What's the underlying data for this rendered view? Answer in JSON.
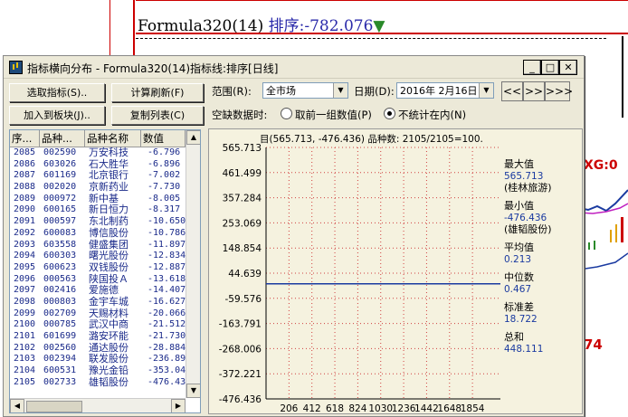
{
  "background": {
    "formula_label": "Formula320(14)",
    "sort_label": "排序:",
    "sort_value": "-782.076",
    "indicator_xg": "XG:0",
    "indicator_74": "74"
  },
  "dialog": {
    "title": "指标横向分布 - Formula320(14)指标线:排序[日线]",
    "buttons": {
      "select_indicator": "选取指标(S)..",
      "calc_refresh": "计算刷新(F)",
      "add_to_block": "加入到板块(J)..",
      "copy_list": "复制列表(C)"
    },
    "range_label": "范围(R):",
    "range_value": "全市场",
    "date_label": "日期(D):",
    "date_value": "2016年 2月16日",
    "nav": [
      "<<",
      ">>",
      ">>>"
    ],
    "empty_data_label": "空缺数据时:",
    "radio_prev": "取前一组数值(P)",
    "radio_skip": "不统计在内(N)",
    "radio_selected": "radio_skip"
  },
  "list": {
    "headers": [
      "序...",
      "品种...",
      "品种名称",
      "数值"
    ],
    "rows": [
      [
        "2085",
        "002590",
        "万安科技",
        "-6.796"
      ],
      [
        "2086",
        "603026",
        "石大胜华",
        "-6.896"
      ],
      [
        "2087",
        "601169",
        "北京银行",
        "-7.002"
      ],
      [
        "2088",
        "002020",
        "京新药业",
        "-7.730"
      ],
      [
        "2089",
        "000972",
        "新中基",
        "-8.005"
      ],
      [
        "2090",
        "600165",
        "新日恒力",
        "-8.317"
      ],
      [
        "2091",
        "000597",
        "东北制药",
        "-10.650"
      ],
      [
        "2092",
        "600083",
        "博信股份",
        "-10.786"
      ],
      [
        "2093",
        "603558",
        "健盛集团",
        "-11.897"
      ],
      [
        "2094",
        "600303",
        "曙光股份",
        "-12.834"
      ],
      [
        "2095",
        "600623",
        "双钱股份",
        "-12.887"
      ],
      [
        "2096",
        "000563",
        "陕国投Ａ",
        "-13.618"
      ],
      [
        "2097",
        "002416",
        "爱施德",
        "-14.407"
      ],
      [
        "2098",
        "000803",
        "金宇车城",
        "-16.627"
      ],
      [
        "2099",
        "002709",
        "天赐材料",
        "-20.066"
      ],
      [
        "2100",
        "000785",
        "武汉中商",
        "-21.512"
      ],
      [
        "2101",
        "601699",
        "潞安环能",
        "-21.730"
      ],
      [
        "2102",
        "002560",
        "通达股份",
        "-28.884"
      ],
      [
        "2103",
        "002394",
        "联发股份",
        "-236.898"
      ],
      [
        "2104",
        "600531",
        "豫光金铅",
        "-353.043"
      ],
      [
        "2105",
        "002733",
        "雄韬股份",
        "-476.436"
      ]
    ]
  },
  "stats": {
    "header": "目(565.713, -476.436) 品种数: 2105/2105=100.",
    "max_label": "最大值",
    "max_value": "565.713",
    "max_name": "(桂林旅游)",
    "min_label": "最小值",
    "min_value": "-476.436",
    "min_name": "(雄韬股份)",
    "avg_label": "平均值",
    "avg_value": "0.213",
    "median_label": "中位数",
    "median_value": "0.467",
    "std_label": "标准差",
    "std_value": "18.722",
    "sum_label": "总和",
    "sum_value": "448.111"
  },
  "chart_data": {
    "type": "line",
    "y_ticks": [
      "565.713",
      "461.499",
      "357.284",
      "253.069",
      "148.854",
      "44.639",
      "-59.576",
      "-163.791",
      "-268.006",
      "-372.221",
      "-476.436"
    ],
    "x_ticks": [
      "206",
      "412",
      "618",
      "824",
      "1030",
      "1236",
      "1442",
      "1648",
      "1854"
    ],
    "ylim": [
      -476.436,
      565.713
    ],
    "xlim": [
      0,
      2105
    ],
    "grid": true,
    "series": [
      {
        "x": [
          0,
          2105
        ],
        "y": [
          0.467,
          0.467
        ]
      }
    ],
    "colors": {
      "grid": "#d04040",
      "line": "#1a3aa0",
      "axis_text": "#000000",
      "stat_value": "#1a3aa0"
    }
  },
  "colors": {
    "dialog_bg": "#ece9d8",
    "panel_bg": "#f5f2df",
    "list_text": "#1a2a8a"
  }
}
